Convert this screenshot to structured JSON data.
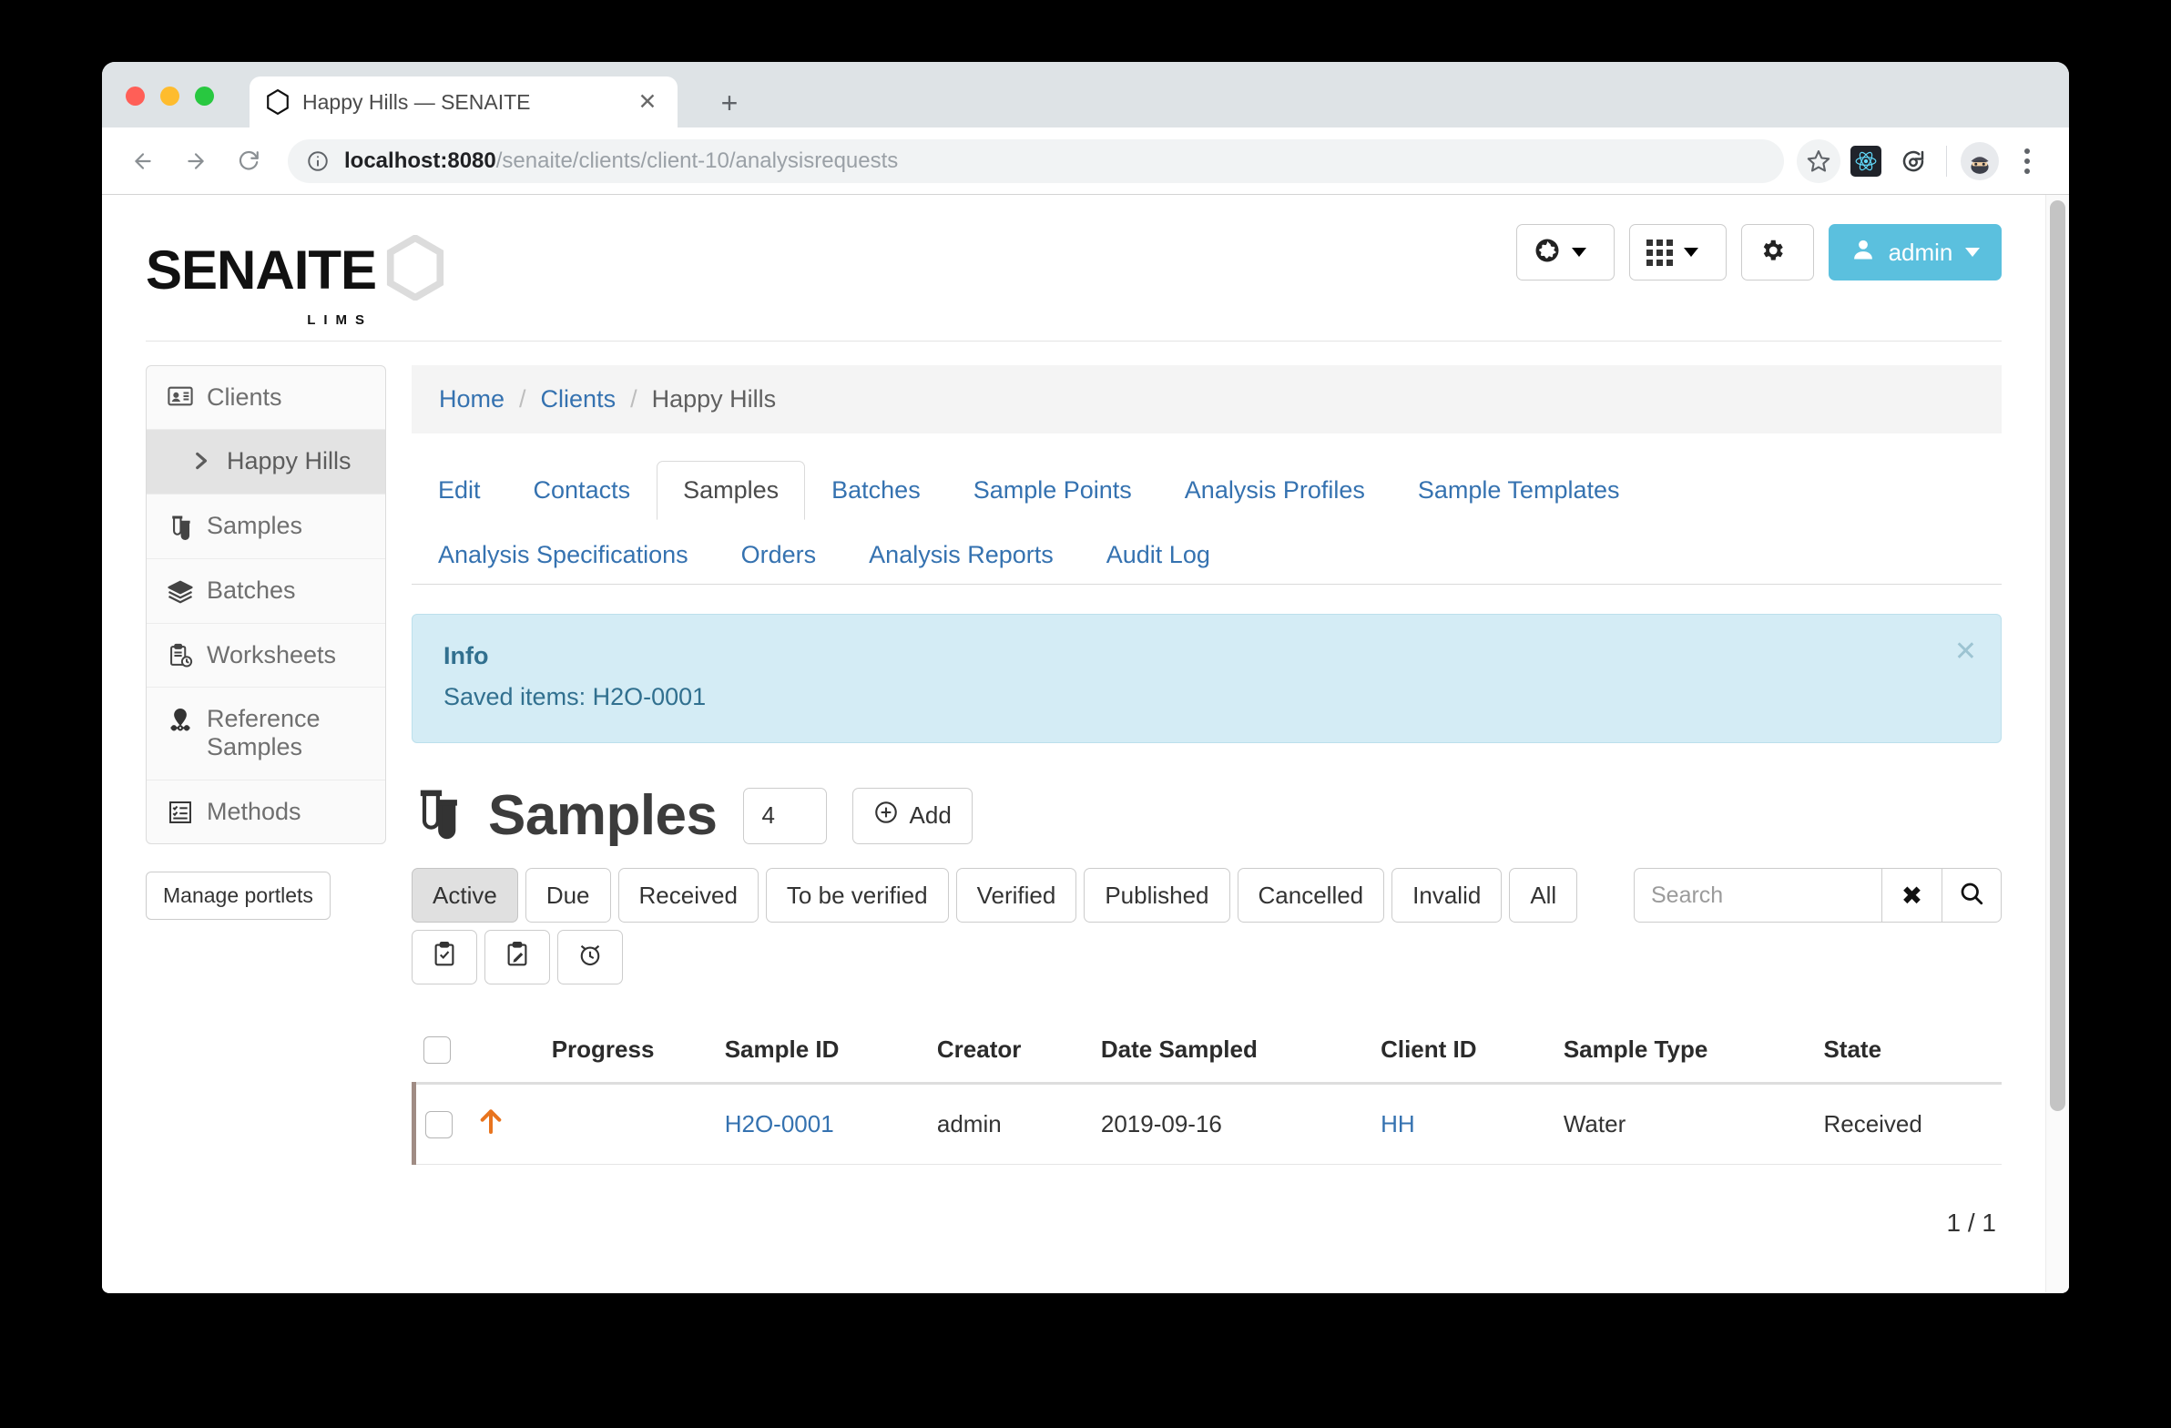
{
  "browser": {
    "tab_title": "Happy Hills — SENAITE",
    "tab_favicon": "hexagon-icon",
    "close_tab_glyph": "✕",
    "new_tab_glyph": "+",
    "url_host": "localhost:8080",
    "url_path": "/senaite/clients/client-10/analysisrequests",
    "icons": {
      "back": "back-arrow-icon",
      "forward": "forward-arrow-icon",
      "reload": "reload-icon",
      "site_info": "info-circle-icon",
      "bookmark": "star-icon",
      "extension_react": "react-devtools-icon",
      "extension_sync": "sync-refresh-icon",
      "profile": "incognito-avatar-icon",
      "menu": "kebab-menu-icon"
    }
  },
  "header": {
    "logo_word": "SENAITE",
    "logo_sub": "LIMS",
    "actions": {
      "language_label": "",
      "apps_label": "",
      "settings_label": "",
      "user_label": "admin"
    }
  },
  "sidebar": {
    "items": [
      {
        "label": "Clients",
        "icon": "id-card-icon",
        "active": false
      },
      {
        "label": "Happy Hills",
        "icon": "chevron-right-icon",
        "active": true
      },
      {
        "label": "Samples",
        "icon": "test-tube-icon",
        "active": false
      },
      {
        "label": "Batches",
        "icon": "layers-icon",
        "active": false
      },
      {
        "label": "Worksheets",
        "icon": "clipboard-clock-icon",
        "active": false
      },
      {
        "label": "Reference Samples",
        "icon": "map-pin-icon",
        "active": false
      },
      {
        "label": "Methods",
        "icon": "checklist-icon",
        "active": false
      }
    ],
    "manage_portlets": "Manage portlets"
  },
  "breadcrumb": {
    "home": "Home",
    "clients": "Clients",
    "current": "Happy Hills",
    "separator": "/"
  },
  "tabs": {
    "row1": [
      {
        "label": "Edit",
        "active": false
      },
      {
        "label": "Contacts",
        "active": false
      },
      {
        "label": "Samples",
        "active": true
      },
      {
        "label": "Batches",
        "active": false
      },
      {
        "label": "Sample Points",
        "active": false
      },
      {
        "label": "Analysis Profiles",
        "active": false
      },
      {
        "label": "Sample Templates",
        "active": false
      }
    ],
    "row2": [
      {
        "label": "Analysis Specifications",
        "active": false
      },
      {
        "label": "Orders",
        "active": false
      },
      {
        "label": "Analysis Reports",
        "active": false
      },
      {
        "label": "Audit Log",
        "active": false
      }
    ]
  },
  "alert": {
    "title": "Info",
    "message": "Saved items: H2O-0001",
    "close_glyph": "✕"
  },
  "listing": {
    "title": "Samples",
    "title_icon": "test-tube-icon",
    "count_value": "4",
    "add_label": "Add",
    "filters_row1": [
      {
        "label": "Active",
        "active": true
      },
      {
        "label": "Due",
        "active": false
      },
      {
        "label": "Received",
        "active": false
      },
      {
        "label": "To be verified",
        "active": false
      },
      {
        "label": "Verified",
        "active": false
      },
      {
        "label": "Published",
        "active": false
      },
      {
        "label": "Cancelled",
        "active": false
      },
      {
        "label": "Invalid",
        "active": false
      }
    ],
    "filters_row2": [
      {
        "label": "All",
        "icon": "",
        "active": false
      },
      {
        "label": "",
        "icon": "clipboard-check-icon",
        "active": false
      },
      {
        "label": "",
        "icon": "clipboard-pencil-icon",
        "active": false
      },
      {
        "label": "",
        "icon": "alarm-clock-icon",
        "active": false
      }
    ],
    "search": {
      "placeholder": "Search",
      "value": "",
      "clear_glyph": "✖",
      "search_icon": "magnifier-icon"
    },
    "columns": [
      "",
      "",
      "Progress",
      "Sample ID",
      "Creator",
      "Date Sampled",
      "Client ID",
      "Sample Type",
      "State"
    ],
    "rows": [
      {
        "priority_icon": "up-arrow-icon",
        "progress": 0,
        "sample_id": "H2O-0001",
        "creator": "admin",
        "date_sampled": "2019-09-16",
        "client_id": "HH",
        "sample_type": "Water",
        "state": "Received"
      }
    ],
    "pagination": "1 / 1"
  },
  "colors": {
    "accent_blue": "#3572b0",
    "user_button": "#5bc0de",
    "alert_bg": "#d4ecf5",
    "alert_text": "#31708f",
    "priority_orange": "#e8741e",
    "row_border": "#a08c84"
  }
}
